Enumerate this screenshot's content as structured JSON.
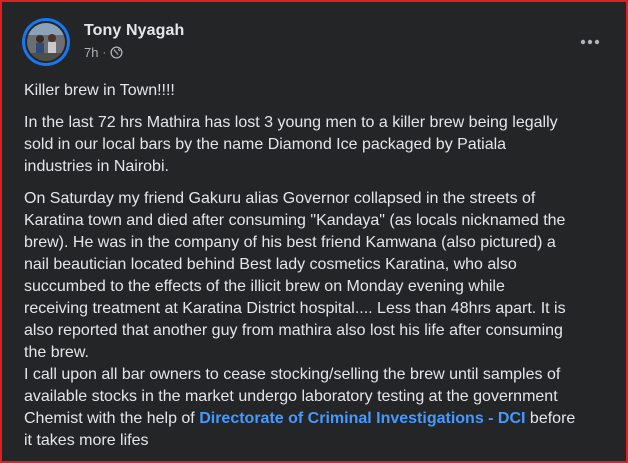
{
  "post": {
    "author": "Tony Nyagah",
    "time": "7h",
    "separator": "·",
    "audience_icon": "globe-icon",
    "more_icon": "more-horizontal-icon",
    "paragraphs": {
      "p1": "Killer brew in Town!!!!",
      "p2": "In the last 72 hrs Mathira has lost 3 young men to a killer brew being legally\nsold in our local bars by the name Diamond Ice packaged by Patiala\nindustries in Nairobi.",
      "p3": "On Saturday my friend Gakuru alias Governor collapsed in the streets of\nKaratina town and died after consuming \"Kandaya\" (as locals nicknamed the\nbrew). He was in the company of his best friend Kamwana (also pictured) a\nnail beautician located behind Best lady cosmetics Karatina, who also\nsuccumbed to the effects of the illicit brew on Monday evening while\nreceiving treatment at Karatina District hospital.... Less than 48hrs apart. It is\nalso reported that another guy from mathira also lost his life after consuming\nthe brew.",
      "p4_before": "I call upon all bar owners to cease stocking/selling the brew until samples of\navailable stocks in the market  undergo laboratory testing at the government\nChemist with the help of ",
      "p4_link": "Directorate of Criminal Investigations - DCI",
      "p4_after": " before\nit takes more lifes"
    }
  },
  "colors": {
    "card_bg": "#242526",
    "text": "#e4e6eb",
    "secondary_text": "#b0b3b8",
    "link": "#4599ff",
    "border": "#e02020",
    "avatar_ring": "#1877f2"
  }
}
